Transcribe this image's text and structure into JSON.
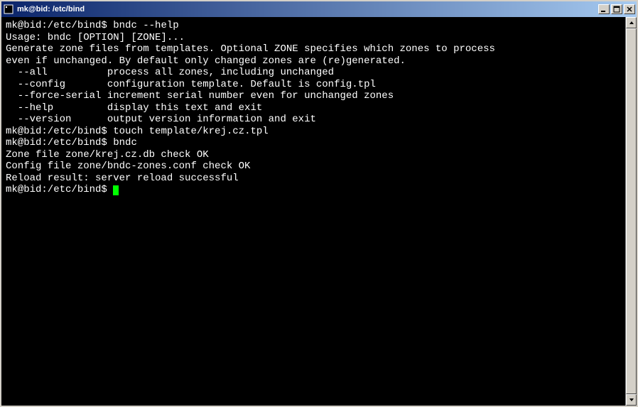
{
  "window": {
    "title": "mk@bid: /etc/bind"
  },
  "terminal": {
    "lines": [
      {
        "prompt": "mk@bid:/etc/bind$ ",
        "cmd": "bndc --help"
      },
      {
        "text": ""
      },
      {
        "text": "Usage: bndc [OPTION] [ZONE]..."
      },
      {
        "text": "Generate zone files from templates. Optional ZONE specifies which zones to process"
      },
      {
        "text": "even if unchanged. By default only changed zones are (re)generated."
      },
      {
        "text": ""
      },
      {
        "text": "  --all          process all zones, including unchanged"
      },
      {
        "text": "  --config       configuration template. Default is config.tpl"
      },
      {
        "text": "  --force-serial increment serial number even for unchanged zones"
      },
      {
        "text": "  --help         display this text and exit"
      },
      {
        "text": "  --version      output version information and exit"
      },
      {
        "text": ""
      },
      {
        "prompt": "mk@bid:/etc/bind$ ",
        "cmd": "touch template/krej.cz.tpl"
      },
      {
        "prompt": "mk@bid:/etc/bind$ ",
        "cmd": "bndc"
      },
      {
        "text": "Zone file zone/krej.cz.db check OK"
      },
      {
        "text": "Config file zone/bndc-zones.conf check OK"
      },
      {
        "text": "Reload result: server reload successful"
      },
      {
        "prompt": "mk@bid:/etc/bind$ ",
        "cmd": "",
        "cursor": true
      }
    ]
  }
}
